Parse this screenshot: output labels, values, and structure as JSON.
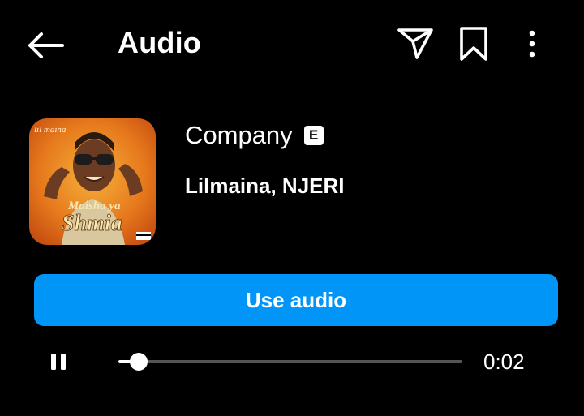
{
  "header": {
    "title": "Audio",
    "icons": {
      "back": "arrow-left-icon",
      "send": "paper-plane-icon",
      "save": "bookmark-icon",
      "more": "more-vertical-icon"
    }
  },
  "track": {
    "title": "Company",
    "explicit_label": "E",
    "artists": "Lilmaina, NJERI",
    "cover_text_top": "lil maina",
    "cover_text_main_1": "Maisha ya",
    "cover_text_main_2": "Shmia"
  },
  "actions": {
    "use_audio_label": "Use audio"
  },
  "player": {
    "state_icon": "pause-icon",
    "progress": 0.06,
    "elapsed": "0:02"
  },
  "colors": {
    "background": "#000000",
    "accent": "#0095f6",
    "track": "#555555"
  }
}
